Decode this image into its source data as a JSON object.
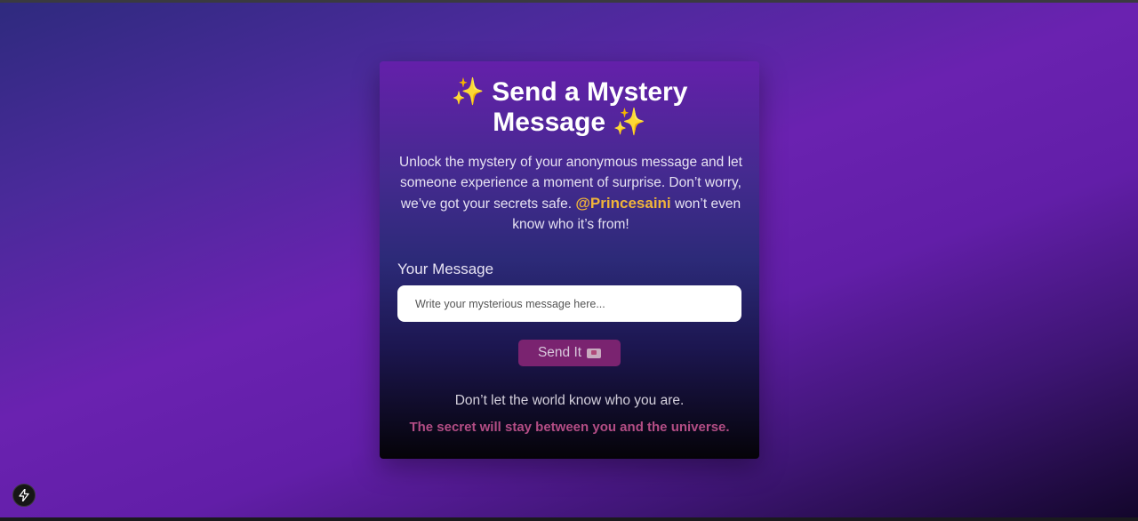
{
  "card": {
    "title": "Send a Mystery Message",
    "sparkle": "✨",
    "intro_before": "Unlock the mystery of your anonymous message and let someone experience a moment of surprise. Don’t worry, we’ve got your secrets safe.",
    "handle": "@Princesaini",
    "intro_after": "won’t even know who it’s from!",
    "field_label": "Your Message",
    "input": {
      "value": "",
      "placeholder": "Write your mysterious message here..."
    },
    "send_label": "Send It",
    "send_icon": "mail-icon",
    "footer_line": "Don’t let the world know who you are.",
    "footer_secret": "The secret will stay between you and the universe."
  },
  "badge": {
    "icon": "bolt-icon"
  },
  "colors": {
    "handle": "#f0b43a",
    "button": "#7a2370",
    "secret_text": "#b34d85"
  }
}
